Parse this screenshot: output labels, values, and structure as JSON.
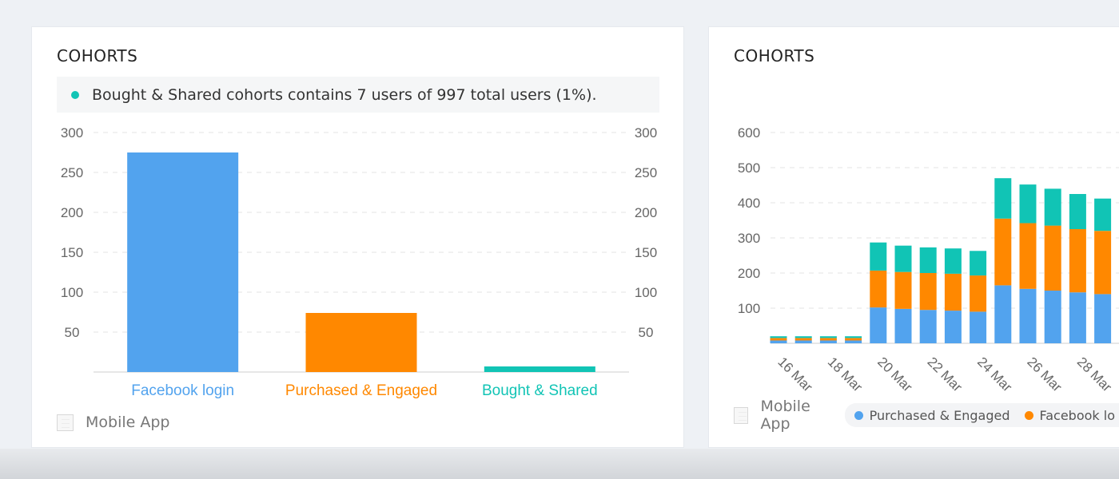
{
  "colors": {
    "facebook": "#52a3ee",
    "purchased": "#ff8800",
    "bought": "#11c4b5",
    "grid": "#e3e3e3",
    "tick": "#666666"
  },
  "left_card": {
    "title": "COHORTS",
    "note": "Bought & Shared cohorts contains 7 users of 997 total users (1%).",
    "footer_label": "Mobile App"
  },
  "right_card": {
    "title": "COHORTS",
    "footer_label": "Mobile App",
    "legend": [
      "Purchased & Engaged",
      "Facebook lo"
    ]
  },
  "chart_data": [
    {
      "type": "bar",
      "categories": [
        "Facebook login",
        "Purchased & Engaged",
        "Bought & Shared"
      ],
      "values": [
        275,
        74,
        7
      ],
      "colors": [
        "#52a3ee",
        "#ff8800",
        "#11c4b5"
      ],
      "ylim": [
        0,
        300
      ],
      "yticks": [
        50,
        100,
        150,
        200,
        250,
        300
      ],
      "y_axis_both_sides": true,
      "grid": true
    },
    {
      "type": "bar",
      "stacked": true,
      "categories": [
        "16 Mar",
        "17 Mar",
        "18 Mar",
        "19 Mar",
        "20 Mar",
        "21 Mar",
        "22 Mar",
        "23 Mar",
        "24 Mar",
        "25 Mar",
        "26 Mar",
        "27 Mar",
        "28 Mar",
        "29 Mar"
      ],
      "xtick_labels": [
        "16 Mar",
        "18 Mar",
        "20 Mar",
        "22 Mar",
        "24 Mar",
        "26 Mar",
        "28 Mar"
      ],
      "series": [
        {
          "name": "Purchased & Engaged",
          "color": "#52a3ee",
          "values": [
            8,
            8,
            8,
            8,
            102,
            98,
            95,
            93,
            90,
            165,
            155,
            150,
            145,
            140
          ]
        },
        {
          "name": "Facebook lo",
          "color": "#ff8800",
          "values": [
            7,
            7,
            7,
            7,
            105,
            105,
            105,
            105,
            103,
            190,
            187,
            185,
            180,
            180
          ]
        },
        {
          "series_color_only": true,
          "color": "#11c4b5",
          "values": [
            5,
            5,
            5,
            5,
            80,
            75,
            73,
            72,
            70,
            115,
            110,
            105,
            100,
            92
          ]
        }
      ],
      "ylim": [
        0,
        600
      ],
      "yticks": [
        100,
        200,
        300,
        400,
        500,
        600
      ],
      "grid": true
    }
  ]
}
